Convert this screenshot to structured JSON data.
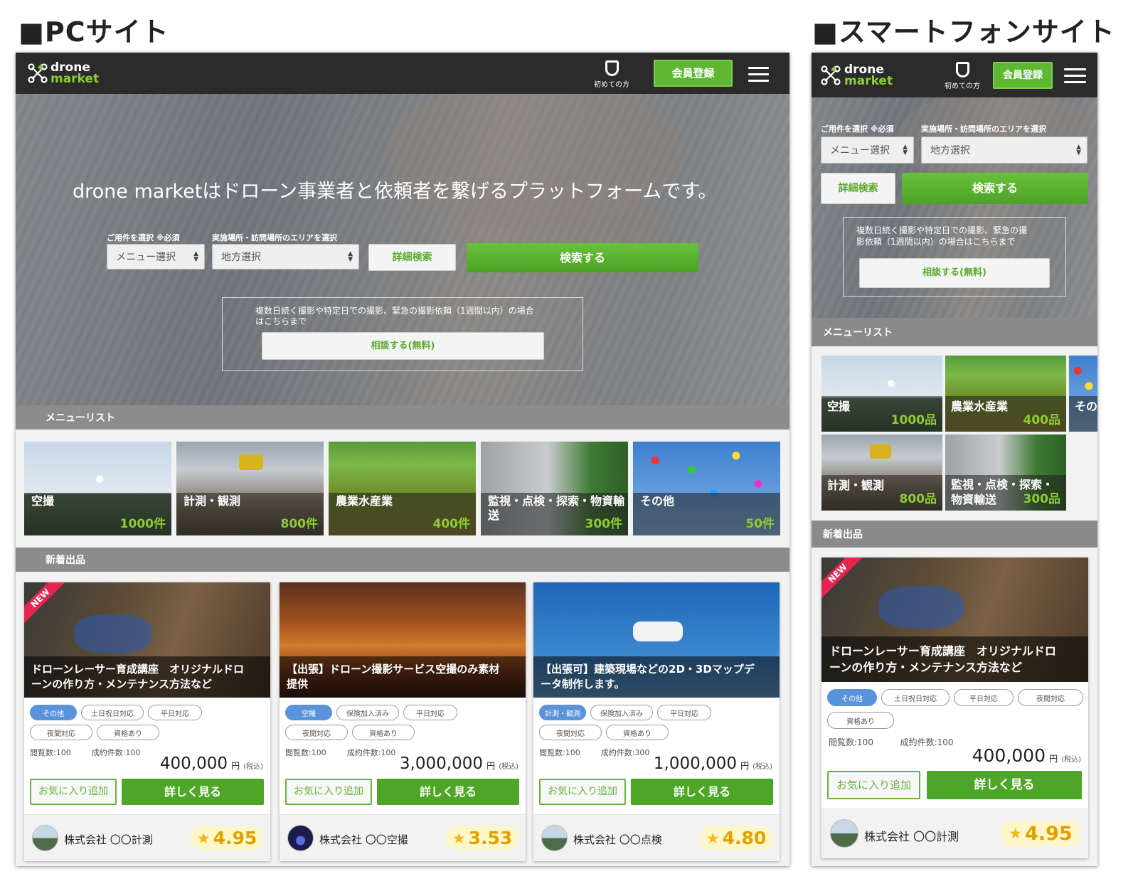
{
  "titles": {
    "pc": "■PCサイト",
    "sp": "■スマートフォンサイト"
  },
  "brand": {
    "line1": "drone",
    "line2": "market"
  },
  "header": {
    "beginners": "初めての方",
    "register": "会員登録",
    "icons": [
      "shield-icon",
      "hamburger-menu-icon"
    ]
  },
  "colors": {
    "accent_green": "#5db733",
    "logo_green": "#8ccc34",
    "header_bg": "#2b2b2b",
    "tag_blue": "#5b93db",
    "new_red": "#e5254f",
    "rating_bg": "#fdf6c8"
  },
  "hero": {
    "headline": "drone marketはドローン事業者と依頼者を繋げるプラットフォームです。",
    "menu_label": "ご用件を選択 ※必須",
    "menu_select": "メニュー選択",
    "area_label": "実施場所・訪問場所のエリアを選択",
    "area_select": "地方選択",
    "detail_search": "詳細検索",
    "search": "検索する",
    "consult_text_pc_1": "複数日続く撮影や特定日での撮影、緊急の撮影依頼（1週間以内）の場合",
    "consult_text_pc_2": "はこちらまで",
    "consult_text_sp_1": "複数日続く撮影や特定日での撮影、緊急の撮",
    "consult_text_sp_2": "影依頼（1週間以内）の場合はこちらまで",
    "consult_btn": "相談する(無料)"
  },
  "menu_list": {
    "title": "メニューリスト",
    "pc": [
      {
        "name": "空撮",
        "count": "1000件"
      },
      {
        "name": "計測・観測",
        "count": "800件"
      },
      {
        "name": "農業水産業",
        "count": "400件"
      },
      {
        "name1": "監視・点検・探索・物資輸",
        "name2": "送",
        "count": "300件"
      },
      {
        "name": "その他",
        "count": "50件"
      }
    ],
    "sp": [
      {
        "name": "空撮",
        "count": "1000品"
      },
      {
        "name": "農業水産業",
        "count": "400品"
      },
      {
        "name": "その"
      },
      {
        "name": "計測・観測",
        "count": "800品"
      },
      {
        "name1": "監視・点検・探索・",
        "name2": "物資輸送",
        "count": "300品"
      }
    ]
  },
  "new_listings": {
    "title": "新着出品",
    "badge": "NEW",
    "fav": "お気に入り追加",
    "details": "詳しく見る",
    "yen": "円",
    "tax": "(税込)",
    "cards": [
      {
        "title1": "ドローンレーサー育成講座　オリジナルドロ",
        "title2": "ーンの作り方・メンテナンス方法など",
        "tags": [
          "その他",
          "土日祝日対応",
          "平日対応",
          "夜間対応",
          "資格あり"
        ],
        "views": "閲覧数:100",
        "deals": "成約件数:100",
        "price": "400,000",
        "company": "株式会社 〇〇計測",
        "rating": "4.95"
      },
      {
        "title1": "【出張】ドローン撮影サービス空撮のみ素材",
        "title2": "提供",
        "tags": [
          "空撮",
          "保険加入済み",
          "平日対応",
          "夜間対応",
          "資格あり"
        ],
        "views": "閲覧数:100",
        "deals": "成約件数:100",
        "price": "3,000,000",
        "company": "株式会社 〇〇空撮",
        "rating": "3.53"
      },
      {
        "title1": "【出張可】建築現場などの2D・3Dマップデ",
        "title2": "ータ制作します。",
        "tags": [
          "計測・観測",
          "保険加入済み",
          "平日対応",
          "夜間対応",
          "資格あり"
        ],
        "views": "閲覧数:100",
        "deals": "成約件数:300",
        "price": "1,000,000",
        "company": "株式会社 〇〇点検",
        "rating": "4.80"
      }
    ]
  }
}
